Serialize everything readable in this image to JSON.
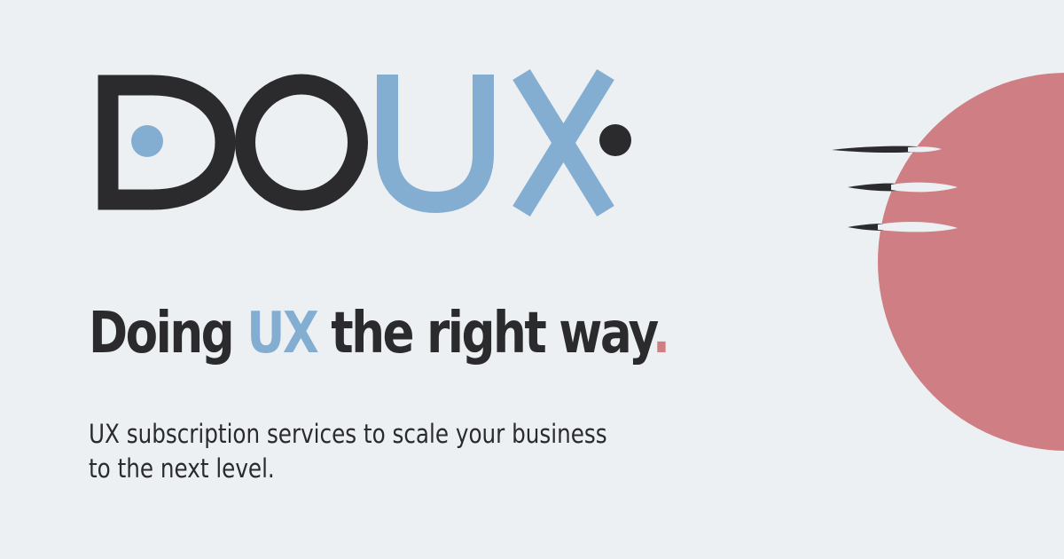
{
  "logo": {
    "name": "DOUX",
    "part_dark": "DO",
    "part_accent": "UX"
  },
  "headline": {
    "before": "Doing",
    "accent": "UX",
    "after": "the right way",
    "period": "."
  },
  "tagline": {
    "line1": "UX subscription services to scale your business",
    "line2": "to the next level."
  },
  "colors": {
    "background": "#edf0f3",
    "dark": "#2b2b2d",
    "accent_blue": "#83aed2",
    "accent_pink": "#cf7f84"
  },
  "icons": {
    "brand_logo": "doux-wordmark",
    "decoration": "speeding-circle-icon"
  }
}
